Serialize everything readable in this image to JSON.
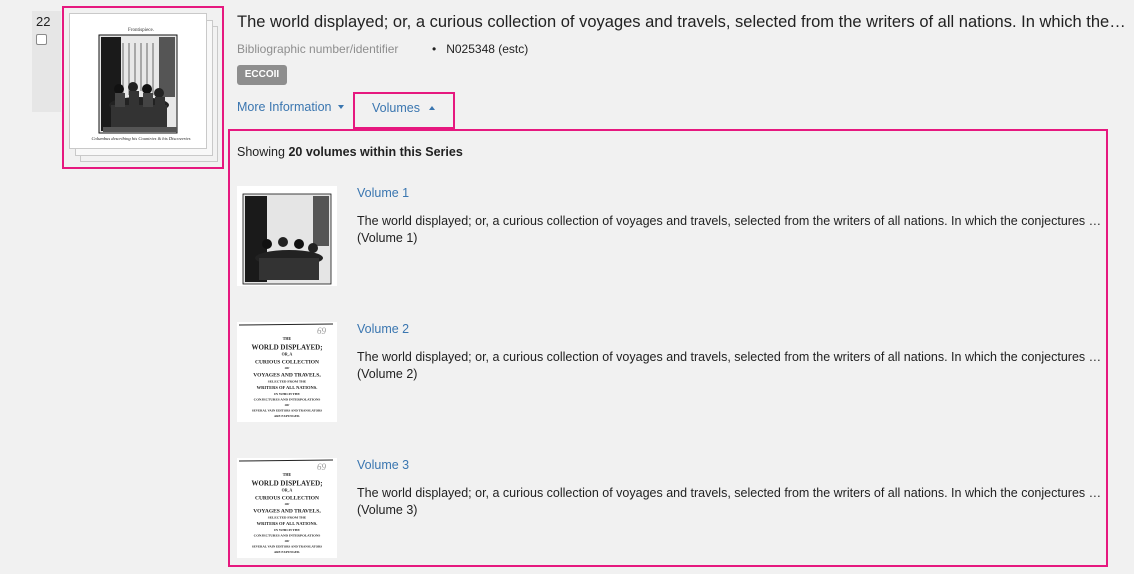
{
  "result": {
    "index": "22",
    "title": "The world displayed; or, a curious collection of voyages and travels, selected from the writers of all nations. In which the conjectures and interpolations of several vain editors and translators are expunged",
    "meta_label": "Bibliographic number/identifier",
    "meta_value": "N025348 (estc)",
    "badge": "ECCOII",
    "more_info_label": "More Information",
    "volumes_tab_label": "Volumes",
    "cover_caption_top": "Frontispiece.",
    "cover_caption_bottom": "Columbus describing his Countries & his Discoveries"
  },
  "volumes": {
    "showing_prefix": "Showing ",
    "showing_count": "20 volumes within this Series",
    "items": [
      {
        "title": "Volume 1",
        "description": "The world displayed; or, a curious collection of voyages and travels, selected from the writers of all nations. In which the conjectures and interpolations of several vain editors and translators are expunged",
        "sub": "(Volume 1)",
        "thumb": "frontispiece"
      },
      {
        "title": "Volume 2",
        "description": "The world displayed; or, a curious collection of voyages and travels, selected from the writers of all nations. In which the conjectures and interpolations of several vain editors and translators are expunged",
        "sub": "(Volume 2)",
        "thumb": "titlepage"
      },
      {
        "title": "Volume 3",
        "description": "The world displayed; or, a curious collection of voyages and travels, selected from the writers of all nations. In which the conjectures and interpolations of several vain editors and translators are expunged",
        "sub": "(Volume 3)",
        "thumb": "titlepage"
      }
    ],
    "titlepage_lines": [
      "THE",
      "WORLD DISPLAYED;",
      "OR, A",
      "CURIOUS COLLECTION",
      "OF",
      "VOYAGES AND TRAVELS,",
      "SELECTED FROM THE",
      "WRITERS OF ALL NATIONS.",
      "IN WHICH THE",
      "CONJECTURES AND INTERPOLATIONS",
      "OF",
      "SEVERAL VAIN EDITORS AND TRANSLATORS",
      "ARE EXPUNGED."
    ]
  },
  "colors": {
    "link": "#3a76b0",
    "highlight": "#e6187f",
    "badge": "#8e8e8e"
  }
}
